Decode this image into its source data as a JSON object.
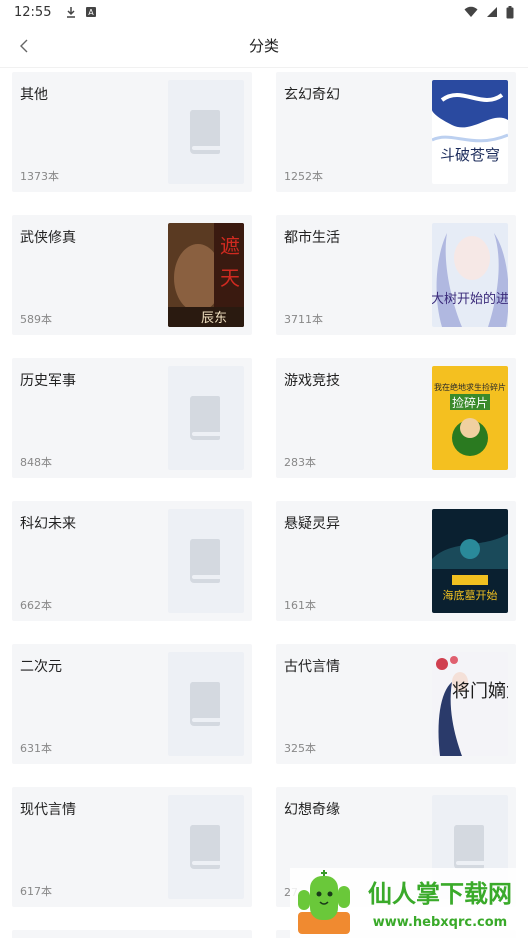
{
  "status_bar": {
    "time": "12:55"
  },
  "header": {
    "title": "分类"
  },
  "categories": [
    {
      "name": "其他",
      "count": "1373本",
      "cover": "placeholder"
    },
    {
      "name": "玄幻奇幻",
      "count": "1252本",
      "cover": "image",
      "cover_text": "斗破苍穹",
      "colors": [
        "#ffffff",
        "#1a3a8a"
      ]
    },
    {
      "name": "武侠修真",
      "count": "589本",
      "cover": "image",
      "cover_text": "辰东",
      "colors": [
        "#4a2a1a",
        "#b0302a"
      ]
    },
    {
      "name": "都市生活",
      "count": "3711本",
      "cover": "image",
      "cover_text": "从大树开始的进化",
      "colors": [
        "#e8eef8",
        "#5a4a9a"
      ]
    },
    {
      "name": "历史军事",
      "count": "848本",
      "cover": "placeholder"
    },
    {
      "name": "游戏竞技",
      "count": "283本",
      "cover": "image",
      "cover_text": "我在绝地求生捡碎片",
      "colors": [
        "#f4c020",
        "#2a7a20"
      ]
    },
    {
      "name": "科幻未来",
      "count": "662本",
      "cover": "placeholder"
    },
    {
      "name": "悬疑灵异",
      "count": "161本",
      "cover": "image",
      "cover_text": "海底墓开始",
      "colors": [
        "#0a2030",
        "#f0c020"
      ]
    },
    {
      "name": "二次元",
      "count": "631本",
      "cover": "placeholder"
    },
    {
      "name": "古代言情",
      "count": "325本",
      "cover": "image",
      "cover_text": "将门嫡女",
      "colors": [
        "#f4f4f8",
        "#2a3a6a"
      ]
    },
    {
      "name": "现代言情",
      "count": "617本",
      "cover": "placeholder"
    },
    {
      "name": "幻想奇缘",
      "count": "27",
      "cover": "placeholder"
    }
  ],
  "watermark": {
    "brand": "仙人掌下载网",
    "url": "www.hebxqrc.com"
  }
}
